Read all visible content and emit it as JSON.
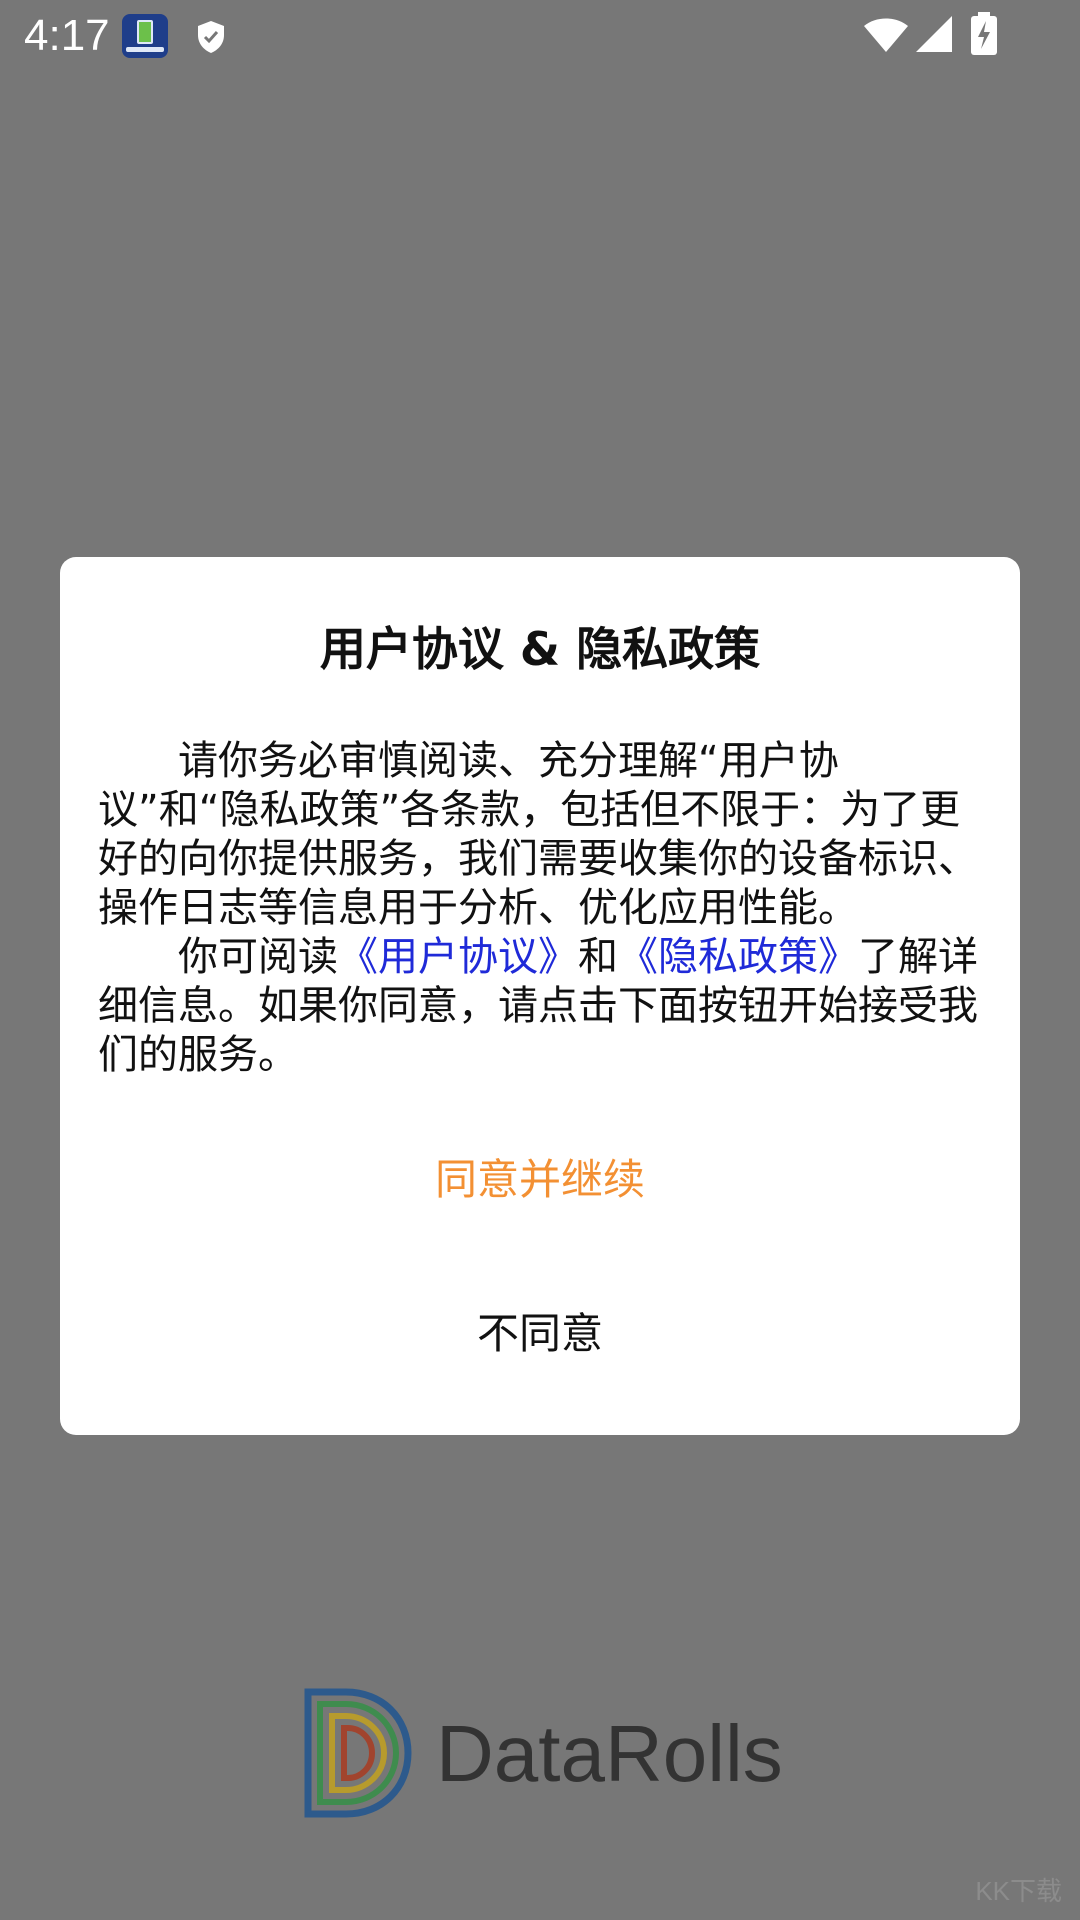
{
  "status_bar": {
    "time": "4:17",
    "icons": [
      "app-icon",
      "shield-icon",
      "wifi-icon",
      "signal-icon",
      "battery-charging-icon"
    ]
  },
  "dialog": {
    "title": "用户协议 & 隐私政策",
    "paragraph1": "请你务必审慎阅读、充分理解“用户协议”和“隐私政策”各条款，包括但不限于：为了更好的向你提供服务，我们需要收集你的设备标识、操作日志等信息用于分析、优化应用性能。",
    "paragraph2_prefix": "你可阅读",
    "user_agreement_link": "《用户协议》",
    "paragraph2_and": "和",
    "privacy_policy_link": "《隐私政策》",
    "paragraph2_suffix": "了解详细信息。如果你同意，请点击下面按钮开始接受我们的服务。",
    "agree_label": "同意并继续",
    "disagree_label": "不同意"
  },
  "brand": {
    "name": "DataRolls"
  },
  "watermark": "KK下载",
  "colors": {
    "overlay": "#777777",
    "link": "#1f2ad8",
    "agree": "#f39033"
  }
}
